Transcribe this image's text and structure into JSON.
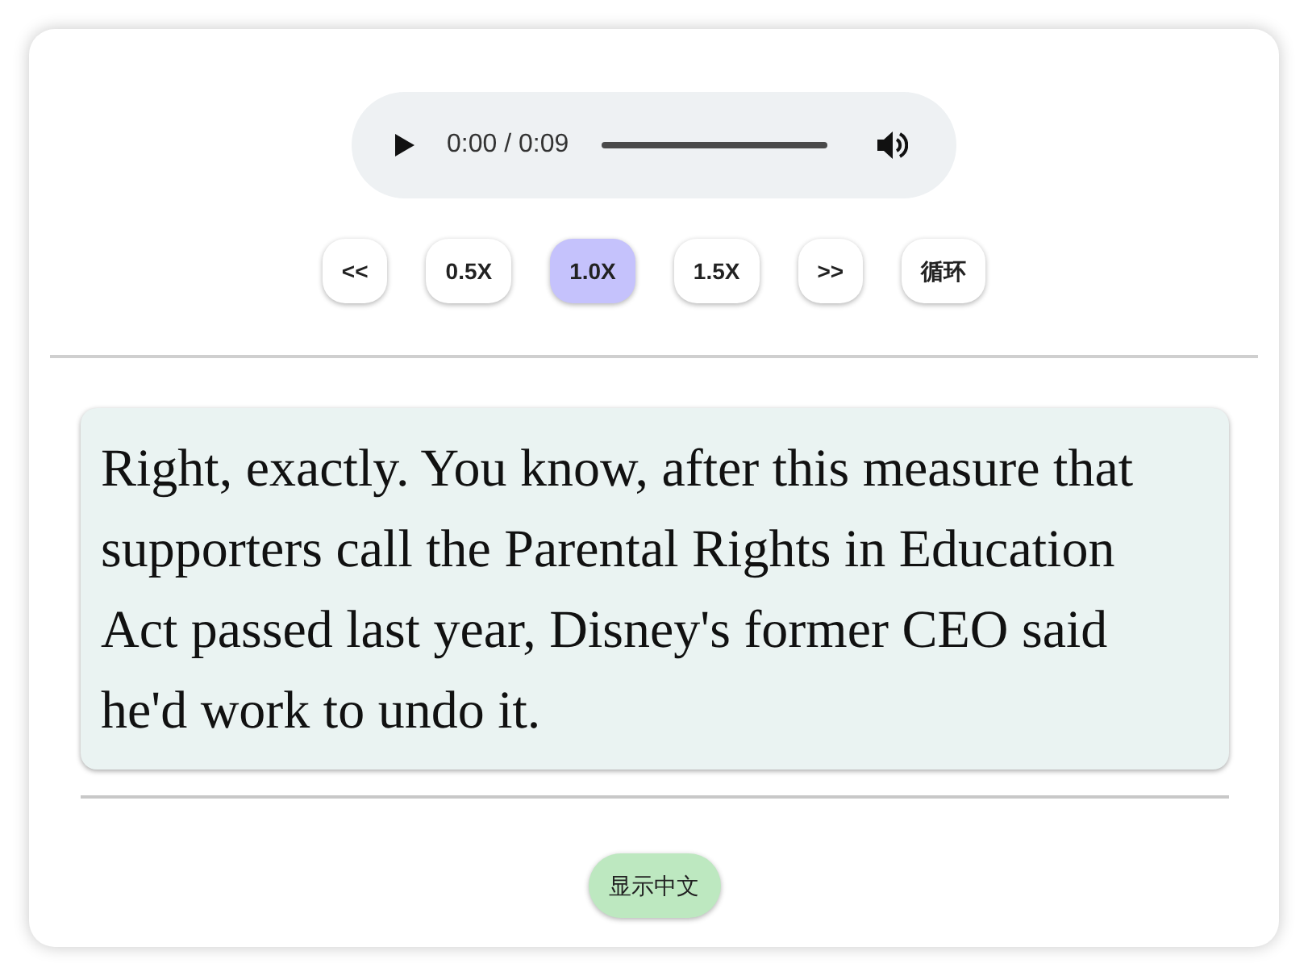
{
  "player": {
    "time": "0:00 / 0:09"
  },
  "controls": [
    {
      "label": "<<",
      "selected": false
    },
    {
      "label": "0.5X",
      "selected": false
    },
    {
      "label": "1.0X",
      "selected": true
    },
    {
      "label": "1.5X",
      "selected": false
    },
    {
      "label": ">>",
      "selected": false
    },
    {
      "label": "循环",
      "selected": false
    }
  ],
  "transcript": {
    "text": "Right, exactly. You know, after this measure that supporters call the Parental Rights in Education Act passed last year, Disney's former CEO said he'd work to undo it."
  },
  "translate_button": {
    "label": "显示中文"
  }
}
